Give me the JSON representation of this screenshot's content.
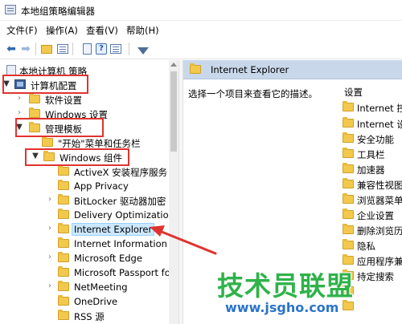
{
  "window": {
    "title": "本地组策略编辑器"
  },
  "menubar": [
    {
      "label": "文件(F)"
    },
    {
      "label": "操作(A)"
    },
    {
      "label": "查看(V)"
    },
    {
      "label": "帮助(H)"
    }
  ],
  "toolbar": {
    "icons": [
      "back-arrow-icon",
      "forward-arrow-icon",
      "up-folder-icon",
      "show-hide-tree-icon",
      "properties-icon",
      "help-icon",
      "export-list-icon",
      "filter-icon"
    ]
  },
  "tree": {
    "root": "本地计算机 策略",
    "computer_config": "计算机配置",
    "software_settings": "软件设置",
    "windows_settings": "Windows 设置",
    "admin_templates": "管理模板",
    "start_menu": "\"开始\"菜单和任务栏",
    "windows_components": "Windows 组件",
    "components": [
      "ActiveX 安装程序服务",
      "App Privacy",
      "BitLocker 驱动器加密",
      "Delivery Optimization",
      "Internet Explorer",
      "Internet Information S",
      "Microsoft Edge",
      "Microsoft Passport for",
      "NetMeeting",
      "OneDrive",
      "RSS 源"
    ]
  },
  "detail": {
    "header_title": "Internet Explorer",
    "description": "选择一个项目来查看它的描述。",
    "column_header": "设置",
    "settings": [
      "Internet 控制",
      "Internet 设置",
      "安全功能",
      "工具栏",
      "加速器",
      "兼容性视图",
      "浏览器菜单",
      "企业设置",
      "删除浏览历史",
      "隐私",
      "应用程序兼容",
      "持定搜索",
      "",
      ""
    ]
  },
  "watermark": {
    "main": "技术员联盟",
    "url": "www.jsgho.com"
  },
  "colors": {
    "highlight_box": "#e0332f",
    "selection": "#cce8ff",
    "detail_header": "#c9d7ea",
    "watermark_green": "#2fb24a",
    "watermark_blue": "#2a74c9"
  }
}
